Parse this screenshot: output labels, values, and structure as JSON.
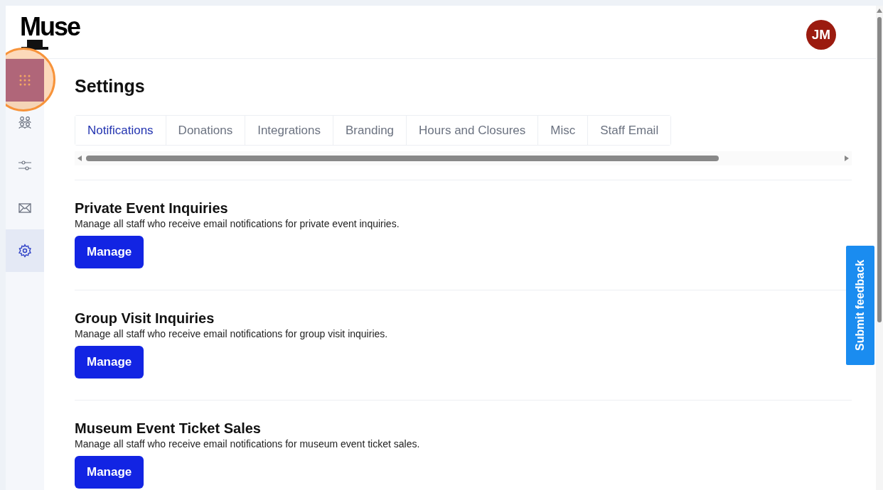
{
  "logo": "Muse",
  "avatar": {
    "initials": "JM"
  },
  "sidebar": {
    "items": [
      {
        "kind": "grid",
        "selected": false,
        "highlighted": true
      },
      {
        "kind": "people",
        "selected": false,
        "highlighted": false
      },
      {
        "kind": "sliders",
        "selected": false,
        "highlighted": false
      },
      {
        "kind": "mail",
        "selected": false,
        "highlighted": false
      },
      {
        "kind": "gear",
        "selected": true,
        "highlighted": false
      }
    ]
  },
  "page_title": "Settings",
  "tabs": [
    {
      "label": "Notifications",
      "selected": true
    },
    {
      "label": "Donations",
      "selected": false
    },
    {
      "label": "Integrations",
      "selected": false
    },
    {
      "label": "Branding",
      "selected": false
    },
    {
      "label": "Hours and Closures",
      "selected": false
    },
    {
      "label": "Misc",
      "selected": false
    },
    {
      "label": "Staff Email",
      "selected": false
    }
  ],
  "sections": [
    {
      "title": "Private Event Inquiries",
      "description": "Manage all staff who receive email notifications for private event inquiries.",
      "button": "Manage"
    },
    {
      "title": "Group Visit Inquiries",
      "description": "Manage all staff who receive email notifications for group visit inquiries.",
      "button": "Manage"
    },
    {
      "title": "Museum Event Ticket Sales",
      "description": "Manage all staff who receive email notifications for museum event ticket sales.",
      "button": "Manage"
    }
  ],
  "feedback_button": "Submit feedback"
}
